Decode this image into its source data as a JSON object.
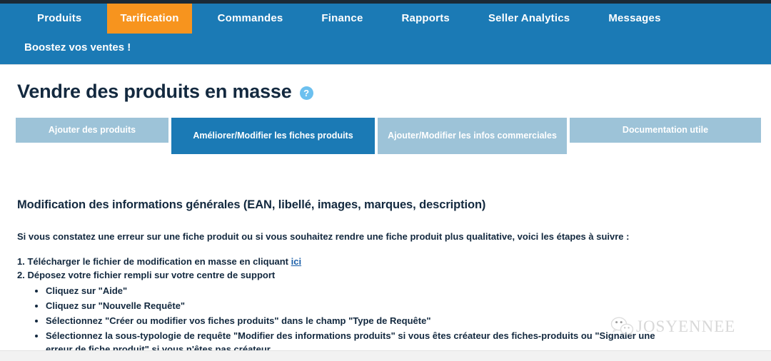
{
  "navbar": {
    "items": [
      {
        "label": "Produits",
        "active": false
      },
      {
        "label": "Tarification",
        "active": true
      },
      {
        "label": "Commandes",
        "active": false
      },
      {
        "label": "Finance",
        "active": false
      },
      {
        "label": "Rapports",
        "active": false
      },
      {
        "label": "Seller Analytics",
        "active": false
      },
      {
        "label": "Messages",
        "active": false
      }
    ],
    "secondary_item": "Boostez vos ventes !",
    "background_color": "#1b7ab5",
    "active_color": "#f7941e",
    "top_strip_color": "#1b2a36"
  },
  "page": {
    "title": "Vendre des produits en masse",
    "help_icon": "?"
  },
  "tabs": [
    {
      "label": "Ajouter des produits",
      "active": false
    },
    {
      "label": "Améliorer/Modifier les fiches produits",
      "active": true
    },
    {
      "label": "Ajouter/Modifier les infos commerciales",
      "active": false
    },
    {
      "label": "Documentation utile",
      "active": false
    }
  ],
  "main": {
    "section_heading": "Modification des informations générales (EAN, libellé, images, marques, description)",
    "intro": "Si vous constatez une erreur sur une fiche produit ou si vous souhaitez rendre une fiche produit plus qualitative, voici les étapes à suivre :",
    "step1_prefix": "1. Télécharger le fichier de modification en masse en cliquant ",
    "step1_link": "ici",
    "step2": "2. Déposez votre fichier rempli sur votre centre de support",
    "bullets": [
      "Cliquez sur \"Aide\"",
      "Cliquez sur \"Nouvelle Requête\"",
      "Sélectionnez \"Créer ou modifier vos fiches produits\" dans le champ \"Type de Requête\"",
      "Sélectionnez la sous-typologie de requête \"Modifier des informations produits\" si vous êtes créateur des fiches-produits ou \"Signaler une erreur de fiche produit\" si vous n'êtes pas créateur"
    ]
  },
  "watermark": {
    "text": "JOSYENNEE",
    "icon": "wechat-icon"
  }
}
